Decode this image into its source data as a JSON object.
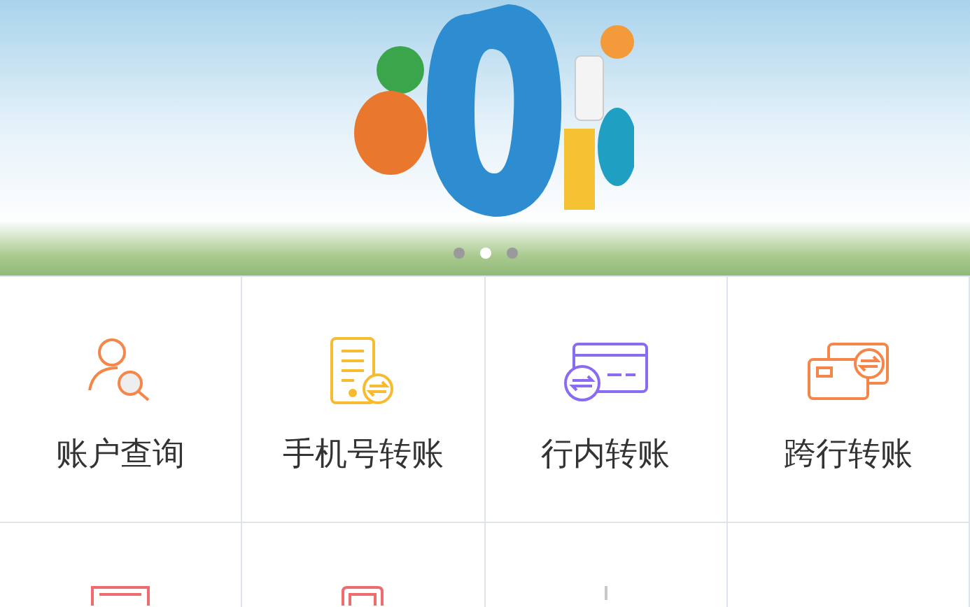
{
  "banner": {
    "dots": [
      {
        "selected": false
      },
      {
        "selected": true
      },
      {
        "selected": false
      }
    ]
  },
  "menu": [
    {
      "kind": "account-search",
      "label": "账户查询"
    },
    {
      "kind": "phone-transfer",
      "label": "手机号转账"
    },
    {
      "kind": "card-transfer",
      "label": "行内转账"
    },
    {
      "kind": "cards-transfer",
      "label": "跨行转账"
    },
    {
      "kind": "red-document"
    },
    {
      "kind": "red-phone"
    },
    {
      "kind": "grey-mark"
    },
    {
      "kind": "blank"
    }
  ]
}
